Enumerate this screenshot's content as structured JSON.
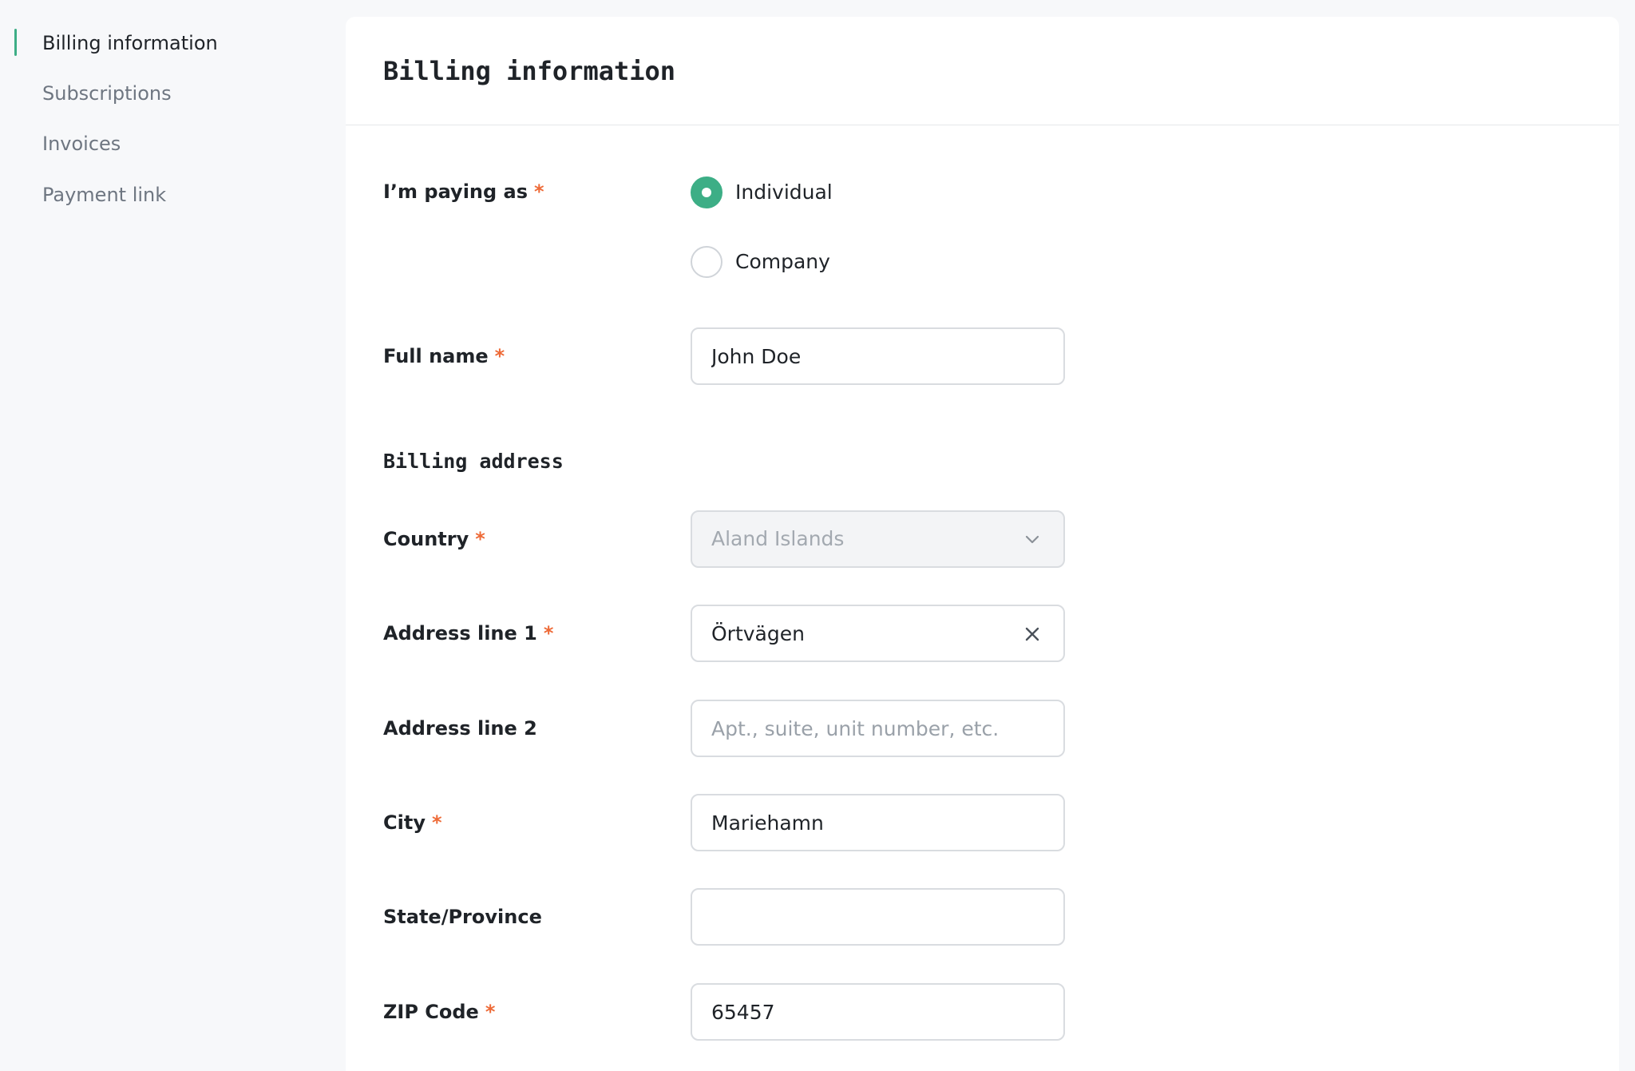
{
  "sidebar": {
    "items": [
      {
        "label": "Billing information",
        "active": true
      },
      {
        "label": "Subscriptions",
        "active": false
      },
      {
        "label": "Invoices",
        "active": false
      },
      {
        "label": "Payment link",
        "active": false
      }
    ]
  },
  "panel": {
    "title": "Billing information"
  },
  "form": {
    "required_marker": "*",
    "paying_as": {
      "label": "I’m paying as",
      "options": [
        {
          "label": "Individual",
          "selected": true
        },
        {
          "label": "Company",
          "selected": false
        }
      ]
    },
    "full_name": {
      "label": "Full name",
      "value": "John Doe"
    },
    "billing_address_title": "Billing address",
    "country": {
      "label": "Country",
      "value": "Aland Islands"
    },
    "address_line_1": {
      "label": "Address line 1",
      "value": "Örtvägen"
    },
    "address_line_2": {
      "label": "Address line 2",
      "value": "",
      "placeholder": "Apt., suite, unit number, etc."
    },
    "city": {
      "label": "City",
      "value": "Mariehamn"
    },
    "state": {
      "label": "State/Province",
      "value": ""
    },
    "zip": {
      "label": "ZIP Code",
      "value": "65457"
    }
  },
  "colors": {
    "accent": "#3dae86",
    "required": "#ee6a37",
    "page_background": "#f7f8fa",
    "panel_background": "#ffffff"
  },
  "icons": {
    "select_arrow": "chevron-down-icon",
    "clear_input": "close-icon"
  }
}
